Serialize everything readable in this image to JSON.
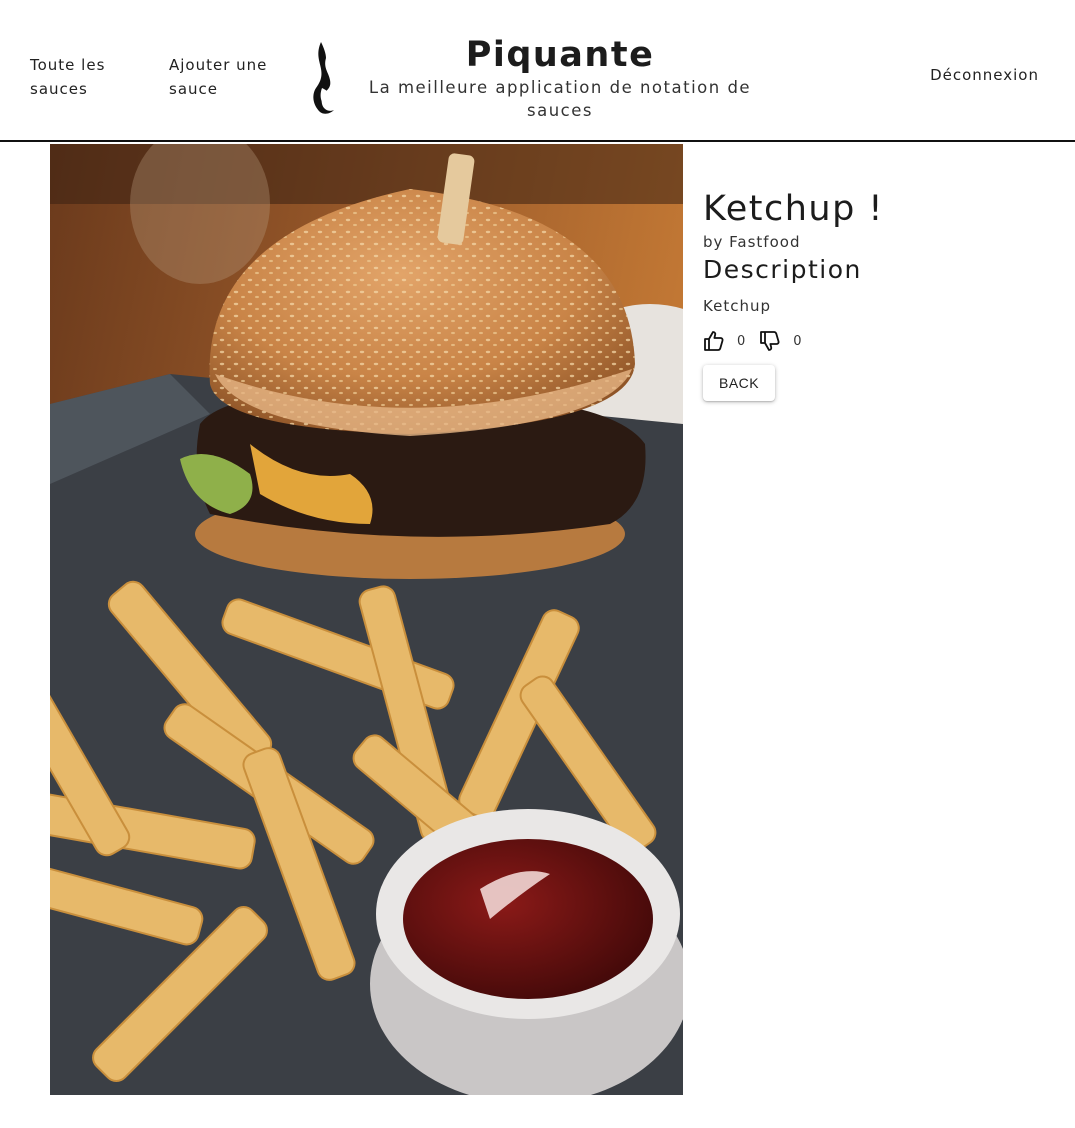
{
  "header": {
    "nav_all": "Toute les sauces",
    "nav_add": "Ajouter une sauce",
    "logo_icon": "flame-icon",
    "title": "Piquante",
    "subtitle": "La meilleure application de notation de sauces",
    "logout": "Déconnexion"
  },
  "sauce": {
    "name": "Ketchup !",
    "maker": "by Fastfood",
    "description_heading": "Description",
    "description": "Ketchup",
    "likes": "0",
    "dislikes": "0",
    "like_icon": "thumbs-up-icon",
    "dislike_icon": "thumbs-down-icon",
    "back_label": "BACK"
  },
  "image": {
    "subject": "burger-fries-ketchup-photo"
  },
  "colors": {
    "header_border": "#111111",
    "text": "#222222",
    "background": "#ffffff"
  }
}
